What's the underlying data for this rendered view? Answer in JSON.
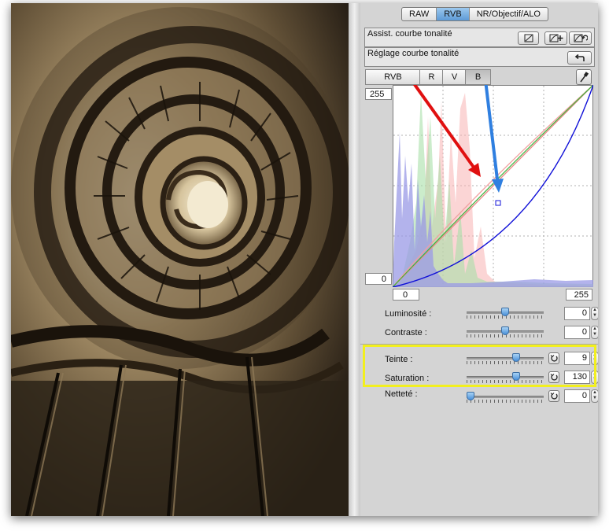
{
  "tabs": [
    {
      "label": "RAW",
      "active": false
    },
    {
      "label": "RVB",
      "active": true
    },
    {
      "label": "NR/Objectif/ALO",
      "active": false
    }
  ],
  "sections": {
    "assist_label": "Assist. courbe tonalité",
    "reglage_label": "Réglage courbe tonalité"
  },
  "channels": [
    {
      "label": "RVB",
      "active": false
    },
    {
      "label": "R",
      "active": false
    },
    {
      "label": "V",
      "active": false
    },
    {
      "label": "B",
      "active": true
    }
  ],
  "curve": {
    "output_max": "255",
    "output_min": "0",
    "input_min": "0",
    "input_max": "255"
  },
  "sliders": [
    {
      "label": "Luminosité :",
      "value": "0",
      "position": 0.5
    },
    {
      "label": "Contraste :",
      "value": "0",
      "position": 0.5
    },
    {
      "label": "Teinte :",
      "value": "9",
      "position": 0.64
    },
    {
      "label": "Saturation :",
      "value": "130",
      "position": 0.64
    },
    {
      "label": "Netteté :",
      "value": "0",
      "position": 0.0
    }
  ],
  "colors": {
    "highlight": "#f2ef1e",
    "red_arrow": "#e01010",
    "blue_arrow": "#2f7fe0",
    "tab_active": "#5d9ad6"
  },
  "icons": {
    "eyedropper": "eyedropper-icon",
    "reset": "reset-arrow-icon"
  }
}
